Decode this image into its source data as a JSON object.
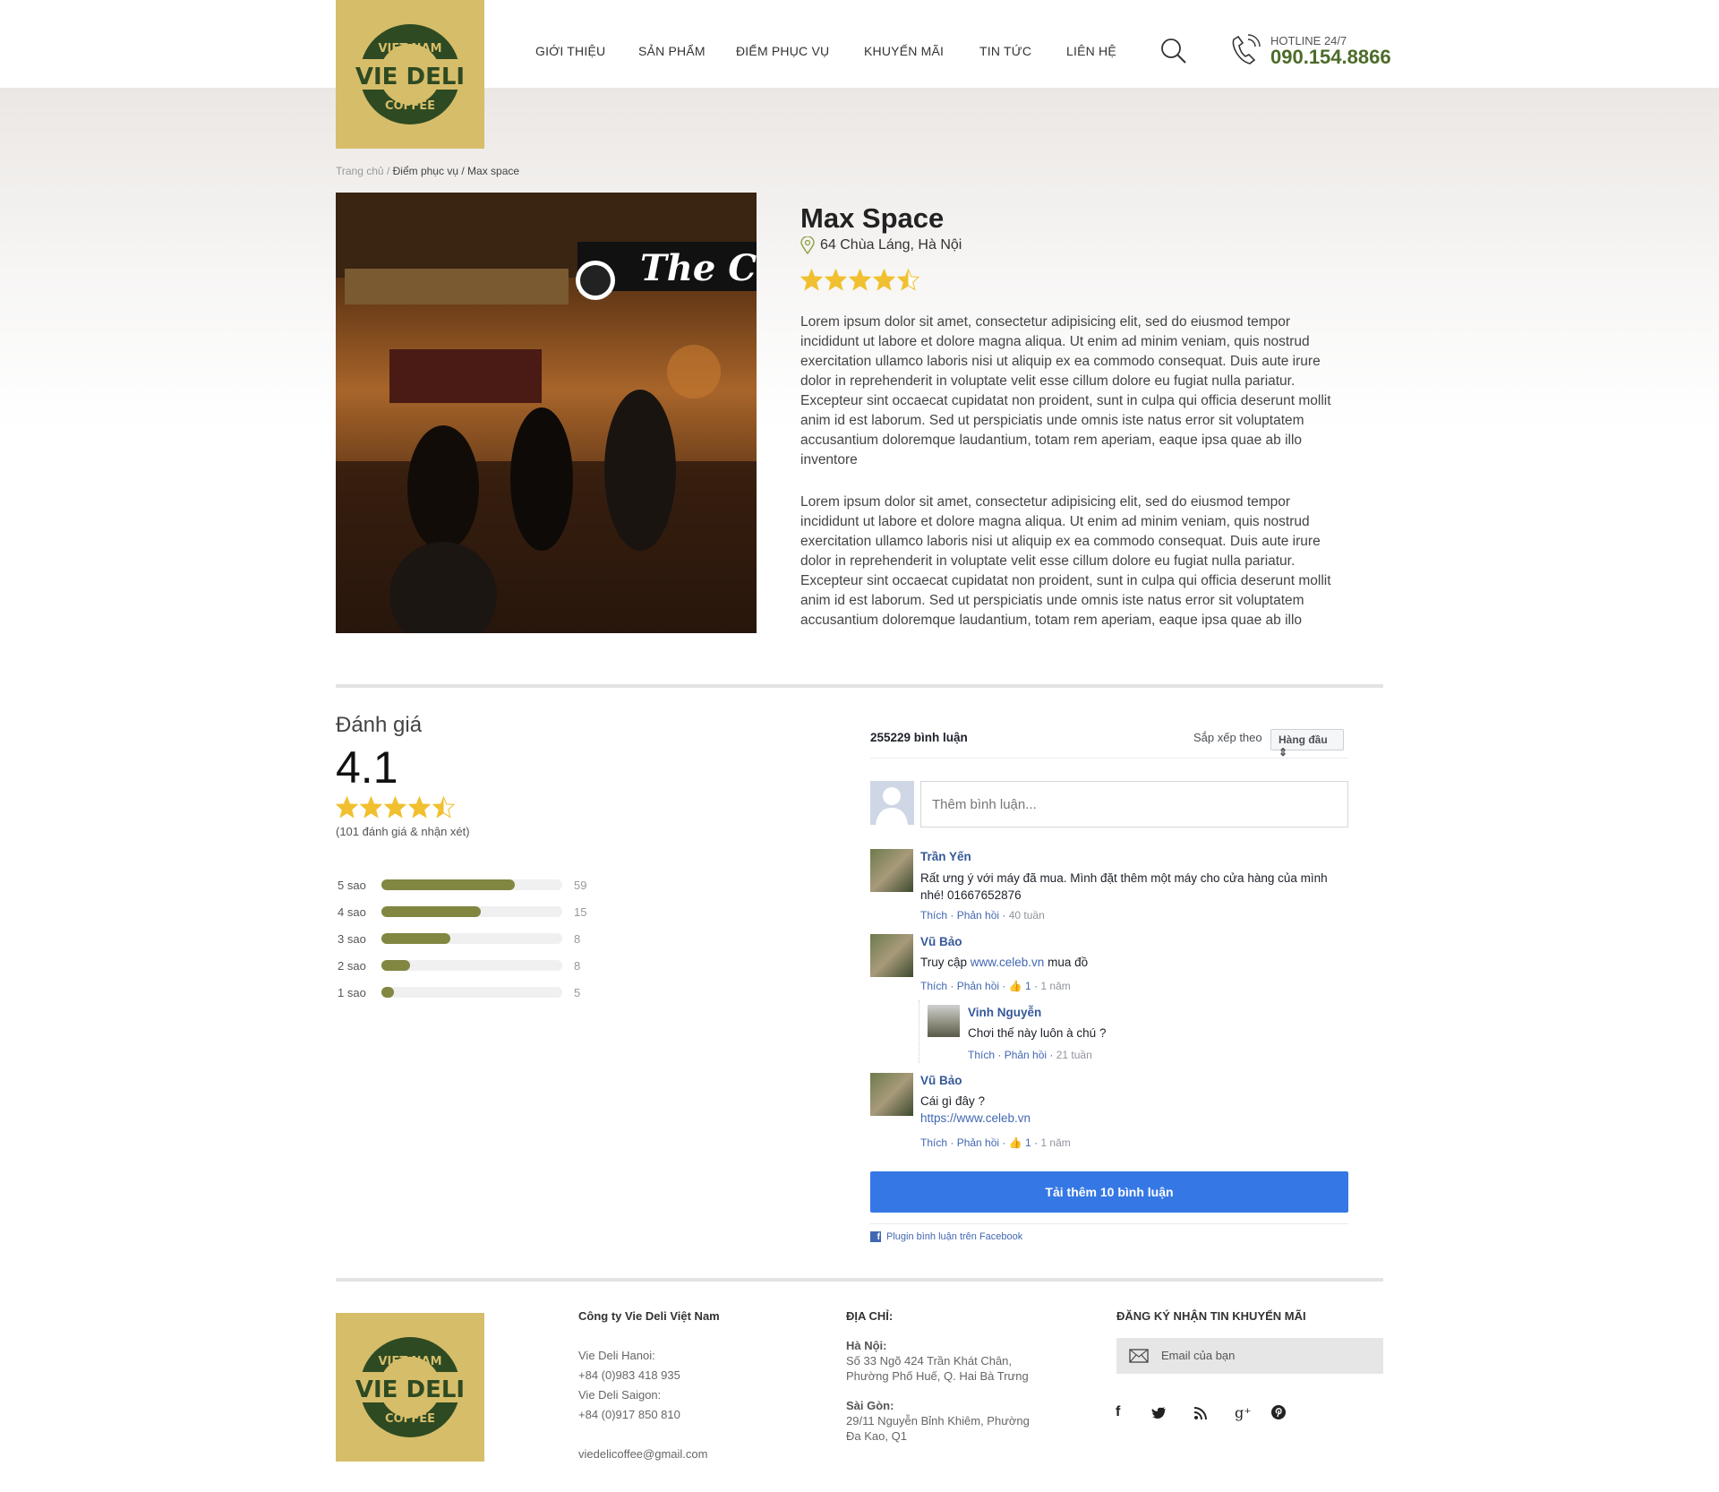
{
  "header": {
    "logo": {
      "line_top": "VIET NAM",
      "line_main": "VIE DELI",
      "line_bottom": "COFFEE"
    },
    "nav": [
      "GIỚI THIỆU",
      "SẢN PHẨM",
      "ĐIỂM PHỤC VỤ",
      "KHUYẾN MÃI",
      "TIN TỨC",
      "LIÊN HỆ"
    ],
    "hotline_label": "HOTLINE 24/7",
    "hotline_number": "090.154.8866",
    "icons": [
      "search-icon",
      "phone-icon"
    ]
  },
  "breadcrumb": {
    "home": "Trang chủ",
    "sep": "/",
    "section": "Điểm phục vụ",
    "current": "Max space"
  },
  "place": {
    "name": "Max Space",
    "address": "64 Chùa Láng, Hà Nội",
    "stars": 4.5,
    "paragraphs": [
      "Lorem ipsum dolor sit amet, consectetur adipisicing elit, sed do eiusmod tempor incididunt ut labore et dolore magna aliqua. Ut enim ad minim veniam, quis nostrud exercitation ullamco laboris nisi ut aliquip ex ea commodo consequat. Duis aute irure dolor in reprehenderit in voluptate velit esse cillum dolore eu fugiat nulla pariatur. Excepteur sint occaecat cupidatat non proident, sunt in culpa qui officia deserunt mollit anim id est laborum. Sed ut perspiciatis unde omnis iste natus error sit voluptatem accusantium doloremque laudantium, totam rem aperiam, eaque ipsa quae ab illo inventore",
      "Lorem ipsum dolor sit amet, consectetur adipisicing elit, sed do eiusmod tempor incididunt ut labore et dolore magna aliqua. Ut enim ad minim veniam, quis nostrud exercitation ullamco laboris nisi ut aliquip ex ea commodo consequat. Duis aute irure dolor in reprehenderit in voluptate velit esse cillum dolore eu fugiat nulla pariatur. Excepteur sint occaecat cupidatat non proident, sunt in culpa qui officia deserunt mollit anim id est laborum. Sed ut perspiciatis unde omnis iste natus error sit voluptatem accusantium doloremque laudantium, totam rem aperiam, eaque ipsa quae ab illo"
    ]
  },
  "reviews": {
    "title": "Đánh giá",
    "score": "4.1",
    "stars": 4.5,
    "count_text": "(101 đánh giá & nhận xét)",
    "bars": [
      {
        "label": "5 sao",
        "count": "59",
        "fill_pct": 74
      },
      {
        "label": "4 sao",
        "count": "15",
        "fill_pct": 55
      },
      {
        "label": "3 sao",
        "count": "8",
        "fill_pct": 38
      },
      {
        "label": "2 sao",
        "count": "8",
        "fill_pct": 16
      },
      {
        "label": "1 sao",
        "count": "5",
        "fill_pct": 7
      }
    ],
    "bar_color": "#818641",
    "star_color": "#f0c030"
  },
  "comments": {
    "count_text": "255229 bình luận",
    "sort_label": "Sắp xếp theo",
    "sort_value": "Hàng đầu",
    "placeholder": "Thêm bình luận...",
    "like": "Thích",
    "reply": "Phản hồi",
    "items": [
      {
        "name": "Trần Yến",
        "text": "Rất ưng ý với máy đã mua. Mình đặt thêm một máy cho cửa hàng của mình nhé! 01667652876",
        "time": "40 tuần"
      },
      {
        "name": "Vũ Bảo",
        "text_before": "Truy cập ",
        "link": "www.celeb.vn",
        "text_after": " mua đồ",
        "likes": "1",
        "time": "1 năm",
        "reply": {
          "name": "Vinh Nguyễn",
          "text": "Chơi thế này luôn à chú ?",
          "time": "21 tuần"
        }
      },
      {
        "name": "Vũ Bảo",
        "text": "Cái gì đây ?",
        "link": "https://www.celeb.vn",
        "likes": "1",
        "time": "1 năm"
      }
    ],
    "load_more": "Tải thêm 10 bình luận",
    "plugin": "Plugin bình luận trên Facebook",
    "button_color": "#3578e5"
  },
  "footer": {
    "company": "Công ty Vie Deli Việt Nam",
    "contacts": [
      "Vie Deli Hanoi:",
      "+84 (0)983 418 935",
      "Vie Deli Saigon:",
      "+84 (0)917 850 810"
    ],
    "email": "viedelicoffee@gmail.com",
    "address_title": "ĐỊA CHỈ:",
    "hanoi_label": "Hà Nội:",
    "hanoi_lines": [
      "Số 33 Ngõ 424 Trần Khát Chân,",
      "Phường Phố Huế, Q. Hai Bà Trưng"
    ],
    "saigon_label": "Sài Gòn:",
    "saigon_lines": [
      "29/11 Nguyễn Bỉnh Khiêm, Phường",
      "Đa Kao, Q1"
    ],
    "newsletter_title": "ĐĂNG KÝ NHẬN TIN KHUYẾN MÃI",
    "newsletter_placeholder": "Email của bạn",
    "social": [
      {
        "name": "facebook",
        "glyph": "f"
      },
      {
        "name": "twitter",
        "glyph": "🐦"
      },
      {
        "name": "rss",
        "glyph": "⊃"
      },
      {
        "name": "google-plus",
        "glyph": "g⁺"
      },
      {
        "name": "pinterest",
        "glyph": "℗"
      }
    ]
  }
}
